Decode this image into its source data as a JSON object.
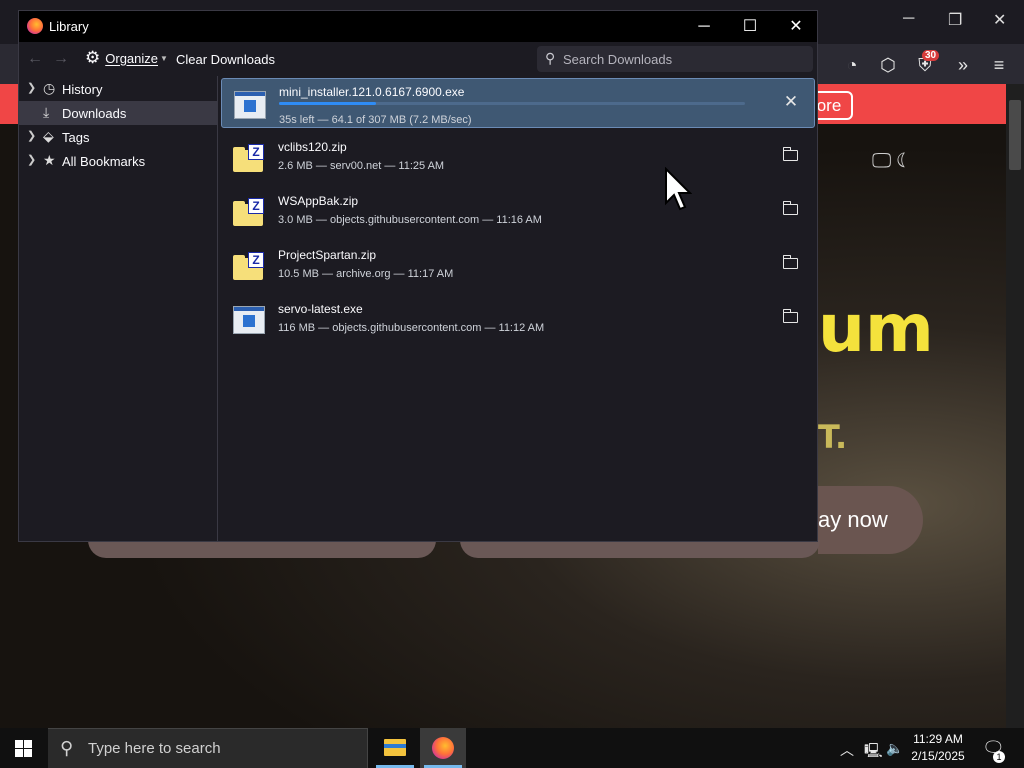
{
  "background": {
    "banner_button": "ore",
    "big_text": "um",
    "sub_text": "T.",
    "play_button": "ay now",
    "toolbar_badge": "30",
    "controls": {
      "minimize": "─",
      "restore": "❐",
      "close": "✕"
    }
  },
  "library": {
    "title": "Library",
    "controls": {
      "minimize": "─",
      "maximize": "☐",
      "close": "✕"
    },
    "toolbar": {
      "organize_label": "Organize",
      "clear_label": "Clear Downloads",
      "search_placeholder": "Search Downloads"
    },
    "sidebar": [
      {
        "label": "History",
        "icon": "clock-icon",
        "has_twisty": true,
        "selected": false
      },
      {
        "label": "Downloads",
        "icon": "download-icon",
        "has_twisty": false,
        "selected": true
      },
      {
        "label": "Tags",
        "icon": "tag-icon",
        "has_twisty": true,
        "selected": false
      },
      {
        "label": "All Bookmarks",
        "icon": "star-icon",
        "has_twisty": true,
        "selected": false
      }
    ],
    "downloads": [
      {
        "name": "mini_installer.121.0.6167.6900.exe",
        "status": "35s left — 64.1 of 307 MB (7.2 MB/sec)",
        "type": "exe",
        "progress": 0.209,
        "active": true,
        "action": "cancel"
      },
      {
        "name": "vclibs120.zip",
        "status": "2.6 MB — serv00.net — 11:25 AM",
        "type": "zip",
        "active": false,
        "action": "show-in-folder"
      },
      {
        "name": "WSAppBak.zip",
        "status": "3.0 MB — objects.githubusercontent.com — 11:16 AM",
        "type": "zip",
        "active": false,
        "action": "show-in-folder"
      },
      {
        "name": "ProjectSpartan.zip",
        "status": "10.5 MB — archive.org — 11:17 AM",
        "type": "zip",
        "active": false,
        "action": "show-in-folder"
      },
      {
        "name": "servo-latest.exe",
        "status": "116 MB — objects.githubusercontent.com — 11:12 AM",
        "type": "exe",
        "active": false,
        "action": "show-in-folder"
      }
    ]
  },
  "taskbar": {
    "search_placeholder": "Type here to search",
    "time": "11:29 AM",
    "date": "2/15/2025",
    "notification_count": "1"
  },
  "colors": {
    "banner": "#f04646",
    "accent_text": "#f4e23c",
    "selection": "#3f5873",
    "progress": "#2f8cf5"
  }
}
